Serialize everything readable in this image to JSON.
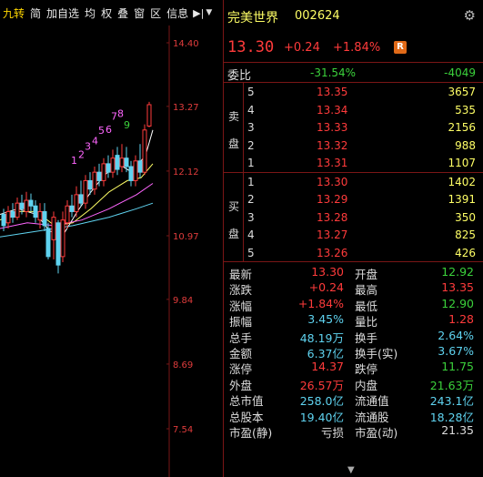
{
  "toolbar": {
    "items": [
      "九转",
      "简",
      "加自选",
      "均",
      "权",
      "叠",
      "窗",
      "区",
      "信息"
    ],
    "pin_icon": "pin-icon",
    "dropdown_icon": "chevron-down-icon"
  },
  "chart": {
    "price_ticks": [
      "14.40",
      "13.27",
      "12.12",
      "10.97",
      "9.84",
      "8.69",
      "7.54"
    ],
    "sequence_labels": [
      {
        "text": "1",
        "color": "#ff66ff"
      },
      {
        "text": "2",
        "color": "#ff66ff"
      },
      {
        "text": "3",
        "color": "#ff66ff"
      },
      {
        "text": "4",
        "color": "#ff66ff"
      },
      {
        "text": "5",
        "color": "#ff66ff"
      },
      {
        "text": "6",
        "color": "#ff66ff"
      },
      {
        "text": "7",
        "color": "#ff66ff"
      },
      {
        "text": "8",
        "color": "#ff66ff"
      },
      {
        "text": "9",
        "color": "#3bd13b"
      }
    ],
    "colors": {
      "up": "#ff3b3b",
      "down": "#5fd3f0",
      "ma5": "#ffffff",
      "ma10": "#ffff66",
      "ma20": "#ff66ff",
      "ma60": "#5fd3f0"
    }
  },
  "stock": {
    "name": "完美世界",
    "code": "002624",
    "price": "13.30",
    "change": "+0.24",
    "change_pct": "+1.84%",
    "badge": "R",
    "settings_icon": "gear-icon"
  },
  "weibi": {
    "label": "委比",
    "ratio": "-31.54%",
    "diff": "-4049"
  },
  "sell": {
    "side_label": [
      "卖",
      "盘"
    ],
    "levels": [
      {
        "n": "5",
        "price": "13.35",
        "vol": "3657"
      },
      {
        "n": "4",
        "price": "13.34",
        "vol": "535"
      },
      {
        "n": "3",
        "price": "13.33",
        "vol": "2156"
      },
      {
        "n": "2",
        "price": "13.32",
        "vol": "988"
      },
      {
        "n": "1",
        "price": "13.31",
        "vol": "1107"
      }
    ]
  },
  "buy": {
    "side_label": [
      "买",
      "盘"
    ],
    "levels": [
      {
        "n": "1",
        "price": "13.30",
        "vol": "1402"
      },
      {
        "n": "2",
        "price": "13.29",
        "vol": "1391"
      },
      {
        "n": "3",
        "price": "13.28",
        "vol": "350"
      },
      {
        "n": "4",
        "price": "13.27",
        "vol": "825"
      },
      {
        "n": "5",
        "price": "13.26",
        "vol": "426"
      }
    ]
  },
  "stats": [
    {
      "l1": "最新",
      "v1": "13.30",
      "c1": "red",
      "l2": "开盘",
      "v2": "12.92",
      "c2": "green"
    },
    {
      "l1": "涨跌",
      "v1": "+0.24",
      "c1": "red",
      "l2": "最高",
      "v2": "13.35",
      "c2": "red"
    },
    {
      "l1": "涨幅",
      "v1": "+1.84%",
      "c1": "red",
      "l2": "最低",
      "v2": "12.90",
      "c2": "green"
    },
    {
      "l1": "振幅",
      "v1": "3.45%",
      "c1": "cyan",
      "l2": "量比",
      "v2": "1.28",
      "c2": "red"
    },
    {
      "l1": "总手",
      "v1": "48.19万",
      "c1": "cyan",
      "l2": "换手",
      "v2": "2.64%",
      "c2": "cyan"
    },
    {
      "l1": "金额",
      "v1": "6.37亿",
      "c1": "cyan",
      "l2": "换手(实)",
      "v2": "3.67%",
      "c2": "cyan"
    },
    {
      "l1": "涨停",
      "v1": "14.37",
      "c1": "red",
      "l2": "跌停",
      "v2": "11.75",
      "c2": "green"
    },
    {
      "l1": "外盘",
      "v1": "26.57万",
      "c1": "red",
      "l2": "内盘",
      "v2": "21.63万",
      "c2": "green"
    },
    {
      "l1": "总市值",
      "v1": "258.0亿",
      "c1": "cyan",
      "l2": "流通值",
      "v2": "243.1亿",
      "c2": "cyan"
    },
    {
      "l1": "总股本",
      "v1": "19.40亿",
      "c1": "cyan",
      "l2": "流通股",
      "v2": "18.28亿",
      "c2": "cyan"
    },
    {
      "l1": "市盈(静)",
      "v1": "亏损",
      "c1": "white",
      "l2": "市盈(动)",
      "v2": "21.35",
      "c2": "white"
    }
  ]
}
